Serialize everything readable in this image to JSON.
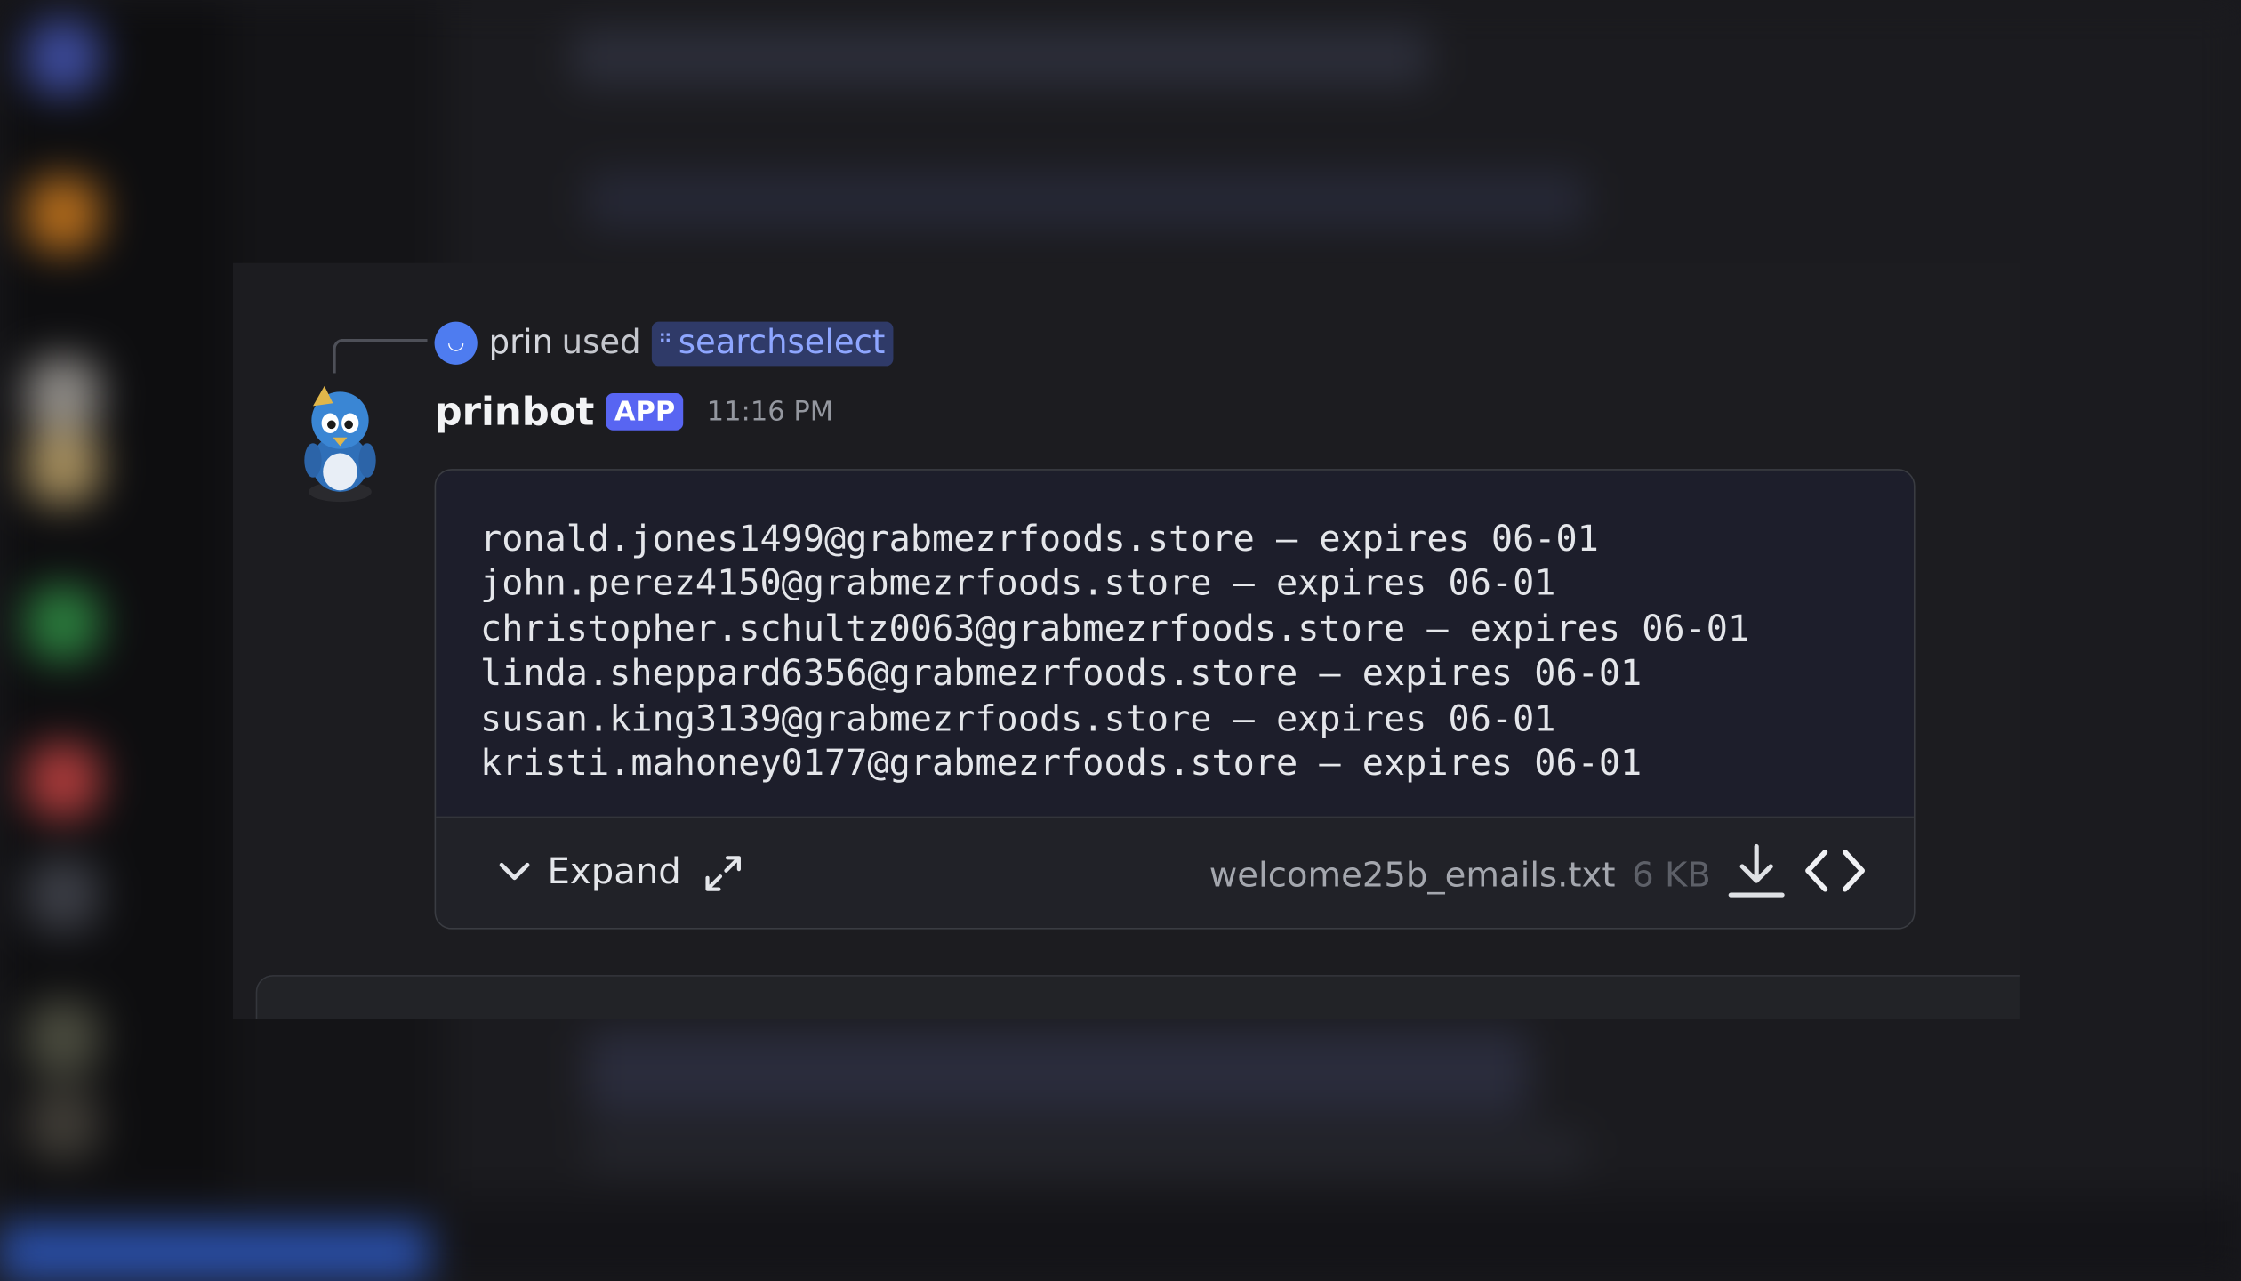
{
  "reply": {
    "user": "prin",
    "used_text": "used",
    "command": "searchselect"
  },
  "message": {
    "author": "prinbot",
    "badge": "APP",
    "timestamp": "11:16 PM",
    "code_lines": [
      "ronald.jones1499@grabmezrfoods.store — expires 06-01",
      "john.perez4150@grabmezrfoods.store — expires 06-01",
      "christopher.schultz0063@grabmezrfoods.store — expires 06-01",
      "linda.sheppard6356@grabmezrfoods.store — expires 06-01",
      "susan.king3139@grabmezrfoods.store — expires 06-01",
      "kristi.mahoney0177@grabmezrfoods.store — expires 06-01"
    ],
    "attachment": {
      "expand_label": "Expand",
      "filename": "welcome25b_emails.txt",
      "size": "6 KB"
    }
  },
  "colors": {
    "accent": "#5865f2",
    "command_pill": "#2f3a68",
    "code_bg": "#1d1e2b"
  },
  "icons": [
    "chevron-down-icon",
    "fullscreen-icon",
    "download-icon",
    "code-icon",
    "command-icon"
  ]
}
